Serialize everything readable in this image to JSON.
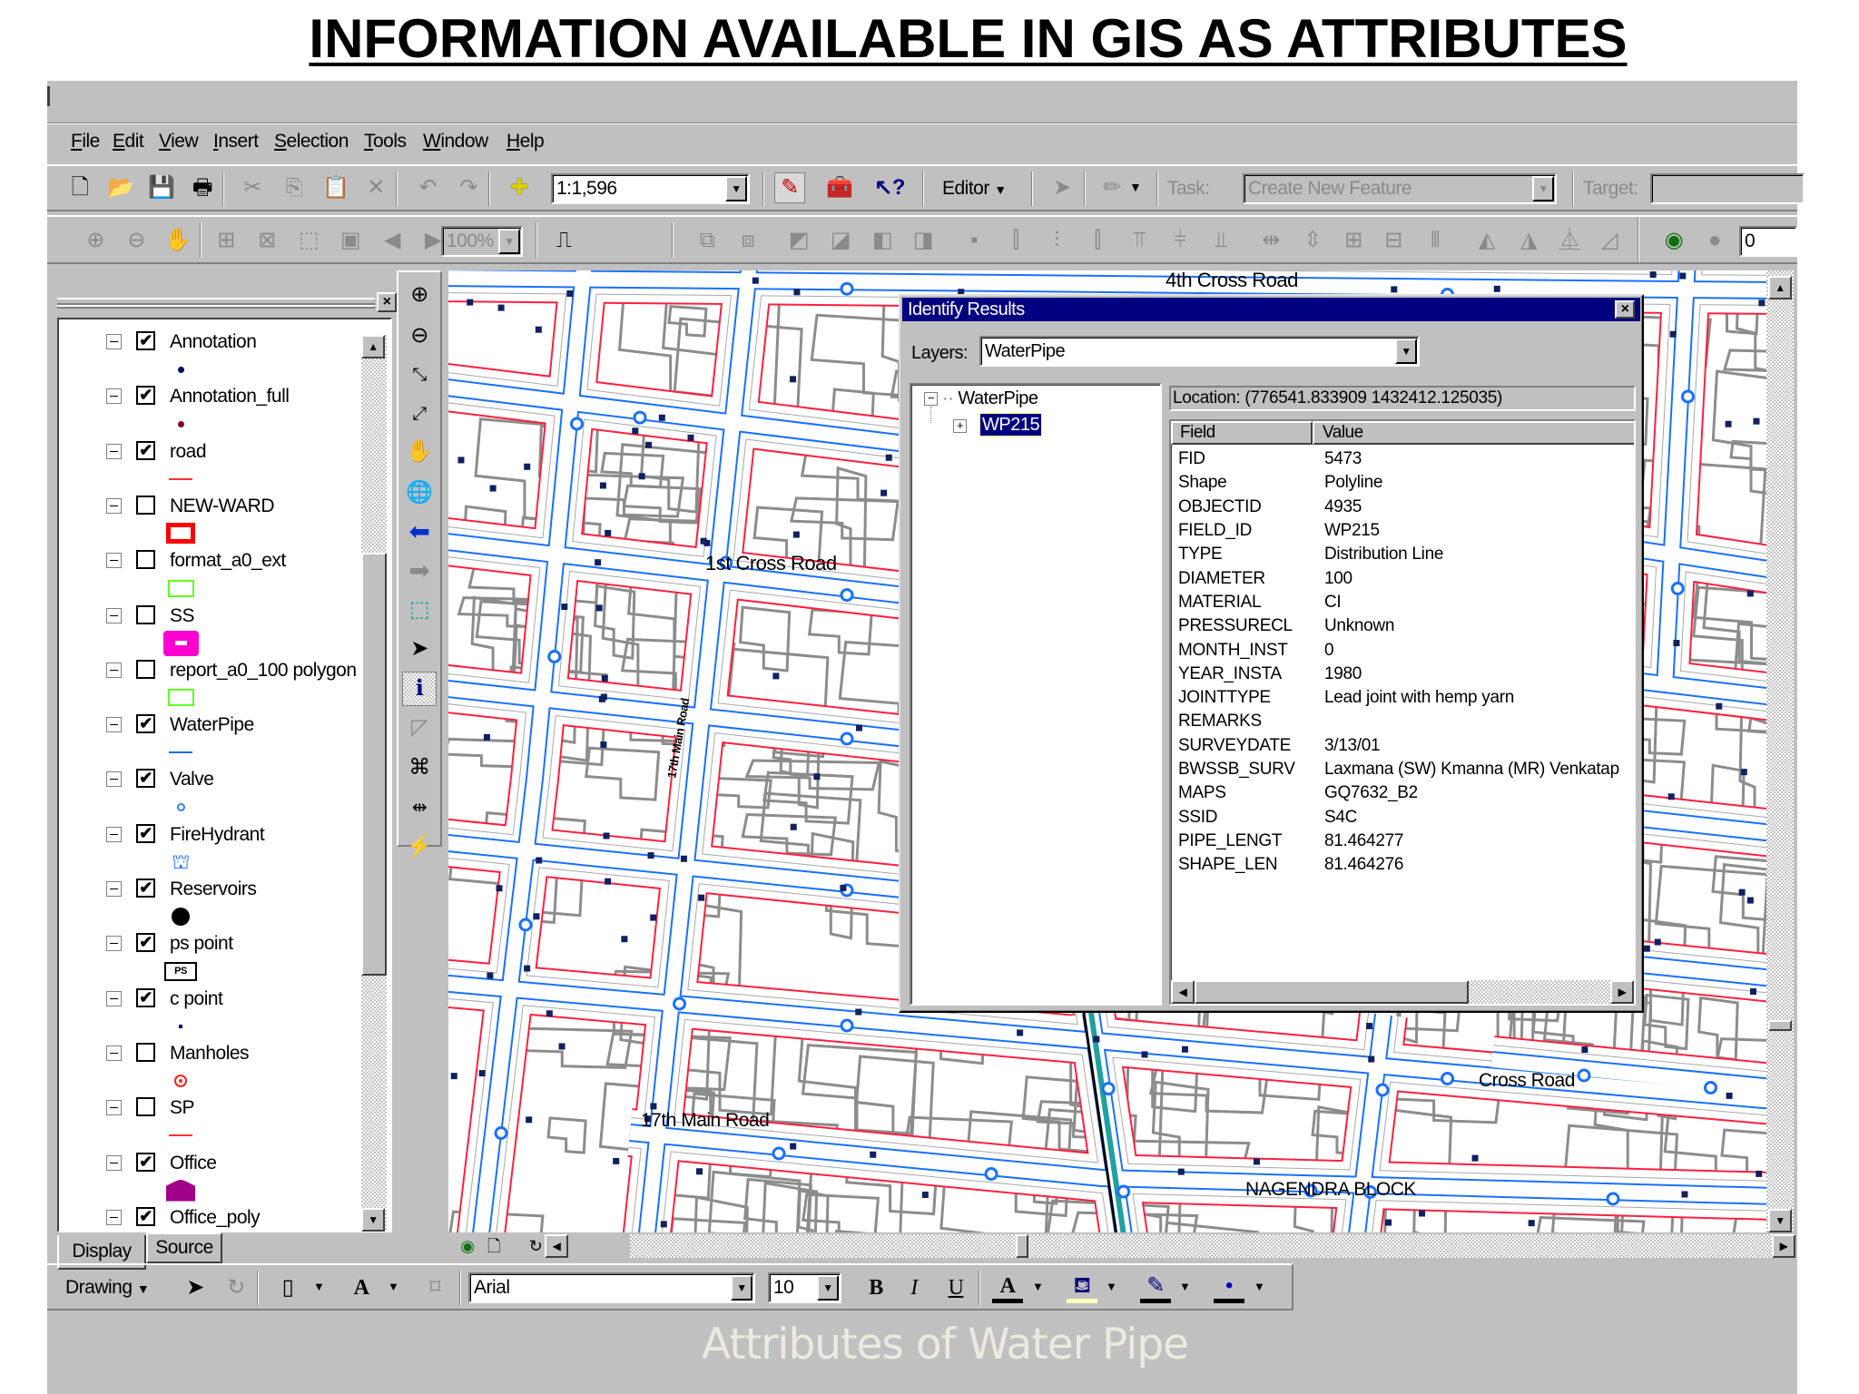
{
  "slide_title": "INFORMATION AVAILABLE IN GIS AS ATTRIBUTES",
  "caption": "Attributes of Water Pipe",
  "menu": [
    "File",
    "Edit",
    "View",
    "Insert",
    "Selection",
    "Tools",
    "Window",
    "Help"
  ],
  "standard_toolbar": {
    "scale": "1:1,596"
  },
  "editor_toolbar": {
    "editor_label": "Editor",
    "task_label": "Task:",
    "task_value": "Create New Feature",
    "target_label": "Target:",
    "target_value": ""
  },
  "layout_toolbar": {
    "zoom_percent": "100%",
    "rotation_value": "0"
  },
  "toc": {
    "layers": [
      {
        "name": "Annotation",
        "checked": true,
        "symbol": "navy-dot"
      },
      {
        "name": "Annotation_full",
        "checked": true,
        "symbol": "maroon-dot"
      },
      {
        "name": "road",
        "checked": true,
        "symbol": "red-line"
      },
      {
        "name": "NEW-WARD",
        "checked": false,
        "symbol": "red-outline-polygon"
      },
      {
        "name": "format_a0_ext",
        "checked": false,
        "symbol": "green-outline-polygon"
      },
      {
        "name": "SS",
        "checked": false,
        "symbol": "magenta-polygon"
      },
      {
        "name": "report_a0_100 polygon",
        "checked": false,
        "symbol": "green-outline-polygon"
      },
      {
        "name": "WaterPipe",
        "checked": true,
        "symbol": "blue-line"
      },
      {
        "name": "Valve",
        "checked": true,
        "symbol": "valve-marker"
      },
      {
        "name": "FireHydrant",
        "checked": true,
        "symbol": "hydrant-marker"
      },
      {
        "name": "Reservoirs",
        "checked": true,
        "symbol": "black-circle"
      },
      {
        "name": "ps point",
        "checked": true,
        "symbol": "ps-box"
      },
      {
        "name": "c point",
        "checked": true,
        "symbol": "small-navy-dot"
      },
      {
        "name": "Manholes",
        "checked": false,
        "symbol": "manhole-marker"
      },
      {
        "name": "SP",
        "checked": false,
        "symbol": "red-line"
      },
      {
        "name": "Office",
        "checked": true,
        "symbol": "office-marker"
      },
      {
        "name": "Office_poly",
        "checked": true,
        "symbol": "black-line"
      }
    ],
    "ps_symbol_text": "PS",
    "tabs": [
      "Display",
      "Source"
    ]
  },
  "map_labels": {
    "fourth_cross": "4th Cross Road",
    "first_cross": "1st Cross Road",
    "main_vertical": "17th Main Road",
    "main_horizontal": "17th Main Road",
    "cross_road": "Cross Road",
    "block": "NAGENDRA BLOCK"
  },
  "identify": {
    "title": "Identify Results",
    "layers_label": "Layers:",
    "layers_value": "WaterPipe",
    "tree_root": "WaterPipe",
    "tree_child": "WP215",
    "location": "Location: (776541.833909 1432412.125035)",
    "headers": [
      "Field",
      "Value"
    ],
    "rows": [
      [
        "FID",
        "5473"
      ],
      [
        "Shape",
        "Polyline"
      ],
      [
        "OBJECTID",
        "4935"
      ],
      [
        "FIELD_ID",
        "WP215"
      ],
      [
        "TYPE",
        "Distribution Line"
      ],
      [
        "DIAMETER",
        "100"
      ],
      [
        "MATERIAL",
        "CI"
      ],
      [
        "PRESSURECL",
        "Unknown"
      ],
      [
        "MONTH_INST",
        "0"
      ],
      [
        "YEAR_INSTA",
        "1980"
      ],
      [
        "JOINTTYPE",
        "Lead joint with hemp yarn"
      ],
      [
        "REMARKS",
        ""
      ],
      [
        "SURVEYDATE",
        "3/13/01"
      ],
      [
        "BWSSB_SURV",
        "Laxmana (SW) Kmanna (MR) Venkatap"
      ],
      [
        "MAPS",
        "GQ7632_B2"
      ],
      [
        "SSID",
        "S4C"
      ],
      [
        "PIPE_LENGT",
        "81.464277"
      ],
      [
        "SHAPE_LEN",
        "81.464276"
      ]
    ]
  },
  "drawing_toolbar": {
    "drawing_label": "Drawing",
    "font": "Arial",
    "font_size": "10",
    "bold": "B",
    "italic": "I",
    "underline": "U"
  }
}
